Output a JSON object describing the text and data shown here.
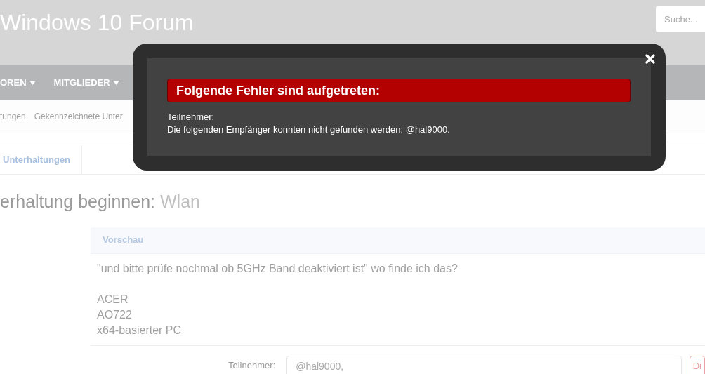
{
  "header": {
    "title": "Windows 10 Forum",
    "search": {
      "placeholder": "Suche..."
    }
  },
  "nav": [
    {
      "label": "OREN",
      "selected": false,
      "dropdown": true
    },
    {
      "label": "MITGLIEDER",
      "selected": false,
      "dropdown": true
    }
  ],
  "tabs": [
    "tungen",
    "Gekennzeichnete Unter"
  ],
  "breadcrumb": "Unterhaltungen",
  "page_title": {
    "prefix": "erhaltung beginnen:",
    "subject": "Wlan"
  },
  "preview": {
    "heading": "Vorschau",
    "paragraphs": [
      [
        "\"und bitte prüfe nochmal ob 5GHz Band deaktiviert ist\" wo finde ich das?"
      ],
      [
        "ACER",
        "AO722",
        "x64-basierter PC"
      ]
    ]
  },
  "form": {
    "label": "Teilnehmer:",
    "value": "@hal9000,",
    "button": "Di"
  },
  "modal": {
    "title": "Folgende Fehler sind aufgetreten:",
    "lines": [
      "Teilnehmer:",
      "Die folgenden Empfänger konnten nicht gefunden werden: @hal9000."
    ]
  }
}
